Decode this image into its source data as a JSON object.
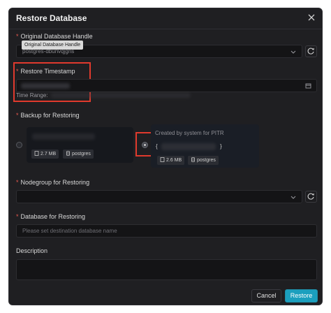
{
  "modal": {
    "title": "Restore Database",
    "close_icon": "close-icon"
  },
  "fields": {
    "handle": {
      "label": "Original Database Handle",
      "value": "postgres-dbunvqjgns",
      "tooltip": "Original Database Handle"
    },
    "timestamp": {
      "label": "Restore Timestamp",
      "time_range_label": "Time Range:"
    },
    "backup": {
      "label": "Backup for Restoring",
      "options": [
        {
          "size": "2.7 MB",
          "engine": "postgres",
          "selected": false
        },
        {
          "subtitle": "Created by system for PITR",
          "brace_open": "{",
          "brace_close": "}",
          "size": "2.6 MB",
          "engine": "postgres",
          "selected": true
        }
      ]
    },
    "nodegroup": {
      "label": "Nodegroup for Restoring"
    },
    "database": {
      "label": "Database for Restoring",
      "placeholder": "Please set destination database name"
    },
    "description": {
      "label": "Description"
    }
  },
  "required_mark": "*",
  "buttons": {
    "cancel": "Cancel",
    "restore": "Restore"
  },
  "colors": {
    "accent": "#1b9fbe",
    "annotation_red": "#e03a2d",
    "required": "#e8594f"
  }
}
